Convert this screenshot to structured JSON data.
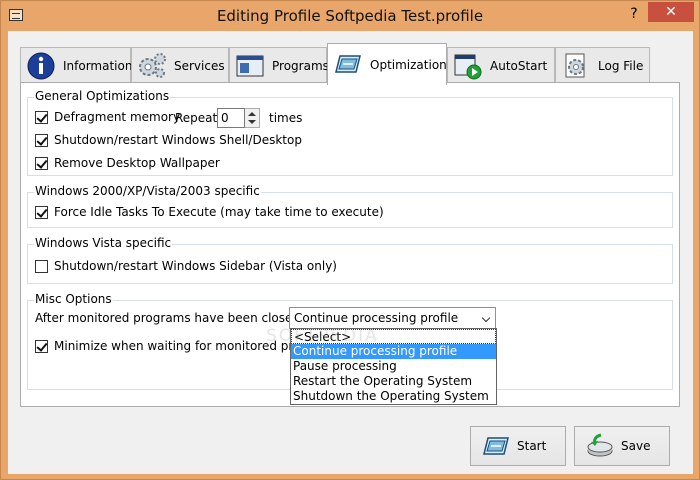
{
  "window": {
    "title": "Editing Profile Softpedia Test.profile",
    "help": "?",
    "close": "✕"
  },
  "tabs": [
    {
      "label": "Information",
      "icon": "info-icon"
    },
    {
      "label": "Services",
      "icon": "services-gear-icon"
    },
    {
      "label": "Programs",
      "icon": "programs-window-icon"
    },
    {
      "label": "Optimization",
      "icon": "optimization-icon",
      "active": true
    },
    {
      "label": "AutoStart",
      "icon": "autostart-play-icon"
    },
    {
      "label": "Log File",
      "icon": "log-file-gear-icon"
    }
  ],
  "general": {
    "legend": "General Optimizations",
    "defrag_label": "Defragment memory",
    "defrag_checked": true,
    "repeat_label": "Repeat",
    "repeat_value": "0",
    "times_label": "times",
    "shutdown_shell_label": "Shutdown/restart Windows Shell/Desktop",
    "shutdown_shell_checked": true,
    "remove_wallpaper_label": "Remove Desktop Wallpaper",
    "remove_wallpaper_checked": true
  },
  "win2000": {
    "legend": "Windows 2000/XP/Vista/2003 specific",
    "idle_label": "Force Idle Tasks To Execute (may take time to execute)",
    "idle_checked": true
  },
  "vista": {
    "legend": "Windows Vista specific",
    "sidebar_label": "Shutdown/restart Windows Sidebar (Vista only)",
    "sidebar_checked": false
  },
  "misc": {
    "legend": "Misc Options",
    "after_label": "After monitored programs have been closed:",
    "selected": "Continue processing profile",
    "options": [
      "<Select>",
      "Continue processing profile",
      "Pause processing",
      "Restart the Operating System",
      "Shutdown the Operating System"
    ],
    "minimize_label": "Minimize when waiting for monitored progra",
    "minimize_checked": true
  },
  "watermark": "SOFTPEDIA",
  "buttons": {
    "start": "Start",
    "save": "Save"
  },
  "colors": {
    "frame": "#e9a66a",
    "close": "#c7503f",
    "selection": "#3399ff"
  }
}
